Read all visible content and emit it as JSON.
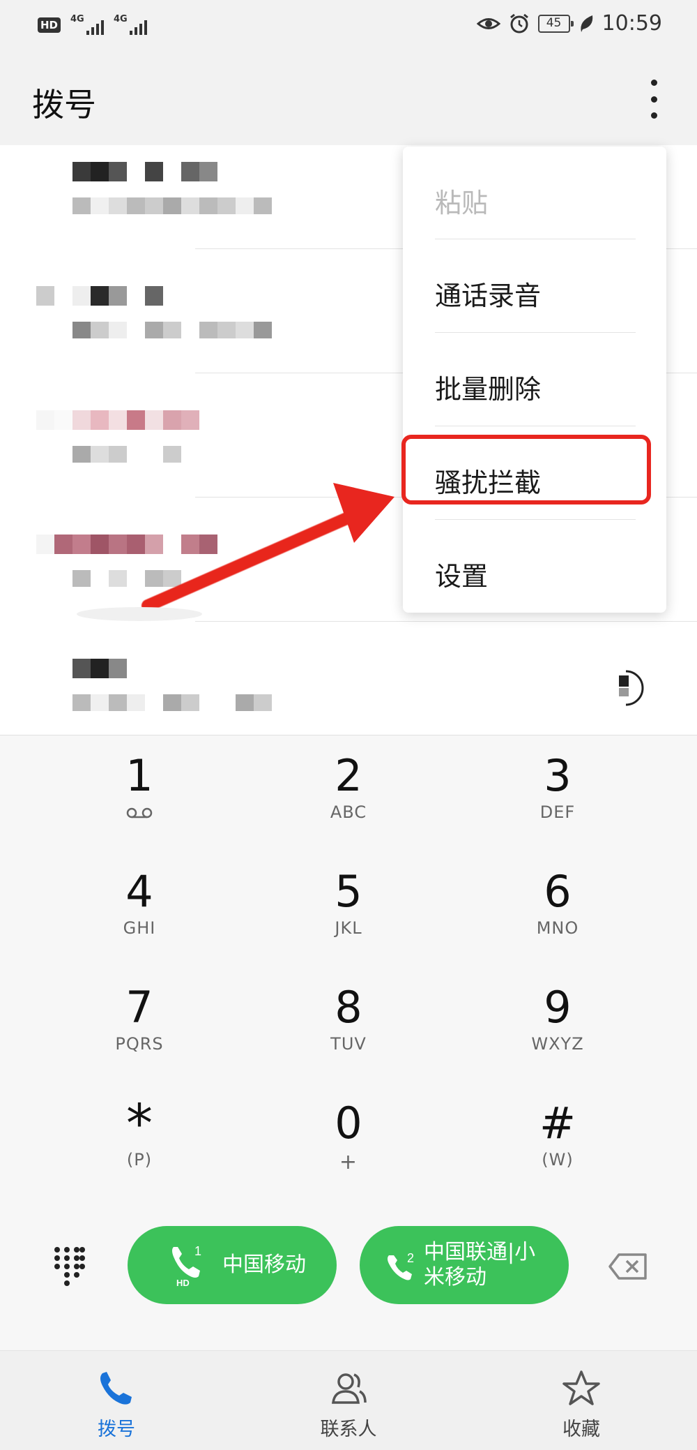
{
  "status_bar": {
    "hd_badge": "HD",
    "sim1_type": "4G",
    "sim2_type": "4G",
    "battery": "45",
    "time": "10:59",
    "icons": [
      "eye-comfort-icon",
      "alarm-icon",
      "battery-icon",
      "leaf-icon"
    ]
  },
  "app_bar": {
    "title": "拨号",
    "more_icon": "more-vertical-icon"
  },
  "overflow_menu": {
    "items": [
      {
        "label": "粘贴",
        "enabled": false
      },
      {
        "label": "通话录音",
        "enabled": true
      },
      {
        "label": "批量删除",
        "enabled": true
      },
      {
        "label": "骚扰拦截",
        "enabled": true,
        "highlighted": true
      },
      {
        "label": "设置",
        "enabled": true
      }
    ]
  },
  "dialpad": {
    "keys": [
      {
        "digit": "1",
        "letters": "",
        "icon": "voicemail-icon"
      },
      {
        "digit": "2",
        "letters": "ABC"
      },
      {
        "digit": "3",
        "letters": "DEF"
      },
      {
        "digit": "4",
        "letters": "GHI"
      },
      {
        "digit": "5",
        "letters": "JKL"
      },
      {
        "digit": "6",
        "letters": "MNO"
      },
      {
        "digit": "7",
        "letters": "PQRS"
      },
      {
        "digit": "8",
        "letters": "TUV"
      },
      {
        "digit": "9",
        "letters": "WXYZ"
      },
      {
        "digit": "*",
        "letters": "(P)"
      },
      {
        "digit": "0",
        "letters": "+"
      },
      {
        "digit": "#",
        "letters": "(W)"
      }
    ]
  },
  "actions": {
    "sim1_call": {
      "label": "中国移动",
      "sim": "1",
      "badge": "HD"
    },
    "sim2_call": {
      "label_line1": "中国联通|小",
      "label_line2": "米移动",
      "sim": "2"
    }
  },
  "bottom_nav": {
    "items": [
      {
        "label": "拨号",
        "icon": "phone-icon",
        "active": true
      },
      {
        "label": "联系人",
        "icon": "contacts-icon",
        "active": false
      },
      {
        "label": "收藏",
        "icon": "star-icon",
        "active": false
      }
    ]
  },
  "colors": {
    "accent": "#1a73d9",
    "call_green": "#3cc25a",
    "highlight_red": "#e8261f"
  }
}
